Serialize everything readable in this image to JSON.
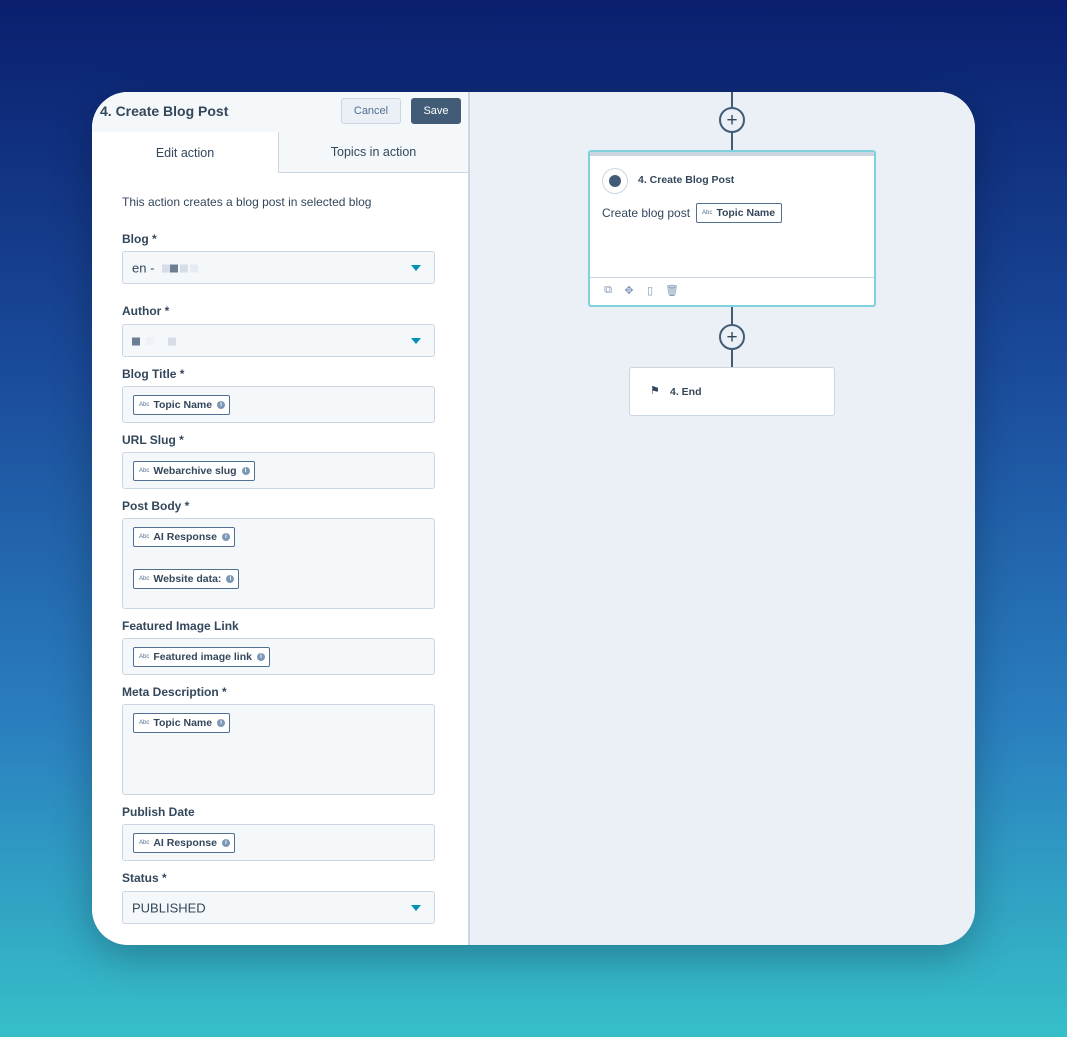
{
  "panel": {
    "title": "4. Create Blog Post",
    "cancel_label": "Cancel",
    "save_label": "Save",
    "tabs": [
      "Edit action",
      "Topics in action"
    ],
    "description": "This action creates a blog post in selected blog"
  },
  "fields": {
    "blog": {
      "label": "Blog *",
      "value": "en -"
    },
    "author": {
      "label": "Author *"
    },
    "blog_title": {
      "label": "Blog Title *",
      "tokens": [
        "Topic Name"
      ]
    },
    "url_slug": {
      "label": "URL Slug *",
      "tokens": [
        "Webarchive slug"
      ]
    },
    "post_body": {
      "label": "Post Body *",
      "tokens": [
        "AI Response",
        "Website data:"
      ]
    },
    "featured_image": {
      "label": "Featured Image Link",
      "tokens": [
        "Featured image link"
      ]
    },
    "meta_description": {
      "label": "Meta Description *",
      "tokens": [
        "Topic Name"
      ]
    },
    "publish_date": {
      "label": "Publish Date",
      "tokens": [
        "AI Response"
      ]
    },
    "status": {
      "label": "Status *",
      "value": "PUBLISHED"
    }
  },
  "token_prefix": "Abc",
  "workflow": {
    "action_node": {
      "title": "4. Create Blog Post",
      "text": "Create blog post",
      "token": "Topic Name",
      "icons": [
        "copy-icon",
        "move-icon",
        "clipboard-icon",
        "trash-icon"
      ]
    },
    "end_node": {
      "label": "4. End"
    }
  },
  "colors": {
    "accent": "#0091ae",
    "primary_button": "#425b76",
    "selected_border": "#7fd1de"
  }
}
